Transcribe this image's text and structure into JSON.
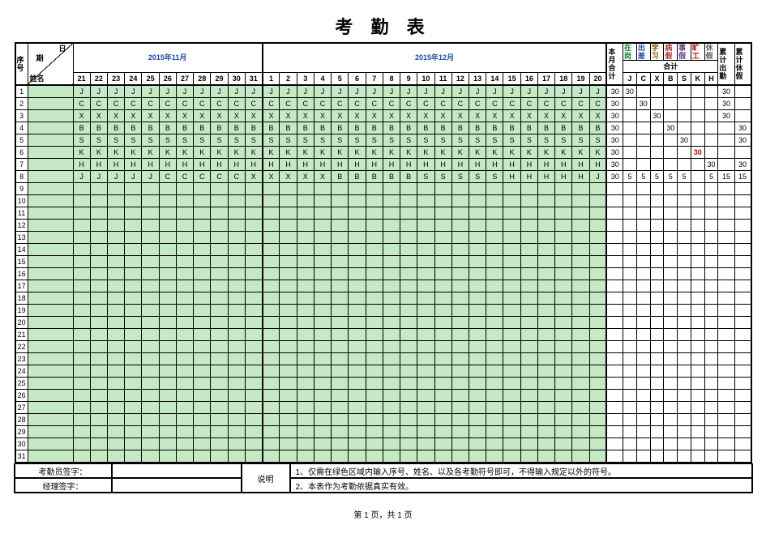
{
  "title": "考 勤 表",
  "header": {
    "seq_label": "序号",
    "corner_top": "日",
    "corner_mid": "期",
    "corner_bot": "姓名",
    "month1": "2015年11月",
    "month2": "2015年12月",
    "days1": [
      "21",
      "22",
      "23",
      "24",
      "25",
      "26",
      "27",
      "28",
      "29",
      "30",
      "31"
    ],
    "days2": [
      "1",
      "2",
      "3",
      "4",
      "5",
      "6",
      "7",
      "8",
      "9",
      "10",
      "11",
      "12",
      "13",
      "14",
      "15",
      "16",
      "17",
      "18",
      "19",
      "20"
    ],
    "month_total": "本月合计",
    "onpost": "在岗",
    "trip": "出差",
    "study": "学习",
    "sick": "病假",
    "personal": "事假",
    "absent": "旷工",
    "rest": "休假",
    "cum_attend": "累计出勤",
    "cum_rest": "累计休假",
    "sub_total": "合计",
    "keys": [
      "J",
      "C",
      "X",
      "B",
      "S",
      "K",
      "H"
    ]
  },
  "chart_data": {
    "type": "table",
    "title": "考勤表",
    "days": [
      21,
      22,
      23,
      24,
      25,
      26,
      27,
      28,
      29,
      30,
      31,
      1,
      2,
      3,
      4,
      5,
      6,
      7,
      8,
      9,
      10,
      11,
      12,
      13,
      14,
      15,
      16,
      17,
      18,
      19,
      20
    ],
    "rows": [
      {
        "seq": 1,
        "marks": [
          "J",
          "J",
          "J",
          "J",
          "J",
          "J",
          "J",
          "J",
          "J",
          "J",
          "J",
          "J",
          "J",
          "J",
          "J",
          "J",
          "J",
          "J",
          "J",
          "J",
          "J",
          "J",
          "J",
          "J",
          "J",
          "J",
          "J",
          "J",
          "J",
          "J",
          "J"
        ],
        "month_total": 30,
        "J": 30,
        "C": "",
        "X": "",
        "B": "",
        "S": "",
        "K": "",
        "H": "",
        "cum_attend": 30,
        "cum_rest": ""
      },
      {
        "seq": 2,
        "marks": [
          "C",
          "C",
          "C",
          "C",
          "C",
          "C",
          "C",
          "C",
          "C",
          "C",
          "C",
          "C",
          "C",
          "C",
          "C",
          "C",
          "C",
          "C",
          "C",
          "C",
          "C",
          "C",
          "C",
          "C",
          "C",
          "C",
          "C",
          "C",
          "C",
          "C",
          "C"
        ],
        "month_total": 30,
        "J": "",
        "C": 30,
        "X": "",
        "B": "",
        "S": "",
        "K": "",
        "H": "",
        "cum_attend": 30,
        "cum_rest": ""
      },
      {
        "seq": 3,
        "marks": [
          "X",
          "X",
          "X",
          "X",
          "X",
          "X",
          "X",
          "X",
          "X",
          "X",
          "X",
          "X",
          "X",
          "X",
          "X",
          "X",
          "X",
          "X",
          "X",
          "X",
          "X",
          "X",
          "X",
          "X",
          "X",
          "X",
          "X",
          "X",
          "X",
          "X",
          "X"
        ],
        "month_total": 30,
        "J": "",
        "C": "",
        "X": 30,
        "B": "",
        "S": "",
        "K": "",
        "H": "",
        "cum_attend": 30,
        "cum_rest": ""
      },
      {
        "seq": 4,
        "marks": [
          "B",
          "B",
          "B",
          "B",
          "B",
          "B",
          "B",
          "B",
          "B",
          "B",
          "B",
          "B",
          "B",
          "B",
          "B",
          "B",
          "B",
          "B",
          "B",
          "B",
          "B",
          "B",
          "B",
          "B",
          "B",
          "B",
          "B",
          "B",
          "B",
          "B",
          "B"
        ],
        "month_total": 30,
        "J": "",
        "C": "",
        "X": "",
        "B": 30,
        "S": "",
        "K": "",
        "H": "",
        "cum_attend": "",
        "cum_rest": 30
      },
      {
        "seq": 5,
        "marks": [
          "S",
          "S",
          "S",
          "S",
          "S",
          "S",
          "S",
          "S",
          "S",
          "S",
          "S",
          "S",
          "S",
          "S",
          "S",
          "S",
          "S",
          "S",
          "S",
          "S",
          "S",
          "S",
          "S",
          "S",
          "S",
          "S",
          "S",
          "S",
          "S",
          "S",
          "S"
        ],
        "month_total": 30,
        "J": "",
        "C": "",
        "X": "",
        "B": "",
        "S": 30,
        "K": "",
        "H": "",
        "cum_attend": "",
        "cum_rest": 30
      },
      {
        "seq": 6,
        "marks": [
          "K",
          "K",
          "K",
          "K",
          "K",
          "K",
          "K",
          "K",
          "K",
          "K",
          "K",
          "K",
          "K",
          "K",
          "K",
          "K",
          "K",
          "K",
          "K",
          "K",
          "K",
          "K",
          "K",
          "K",
          "K",
          "K",
          "K",
          "K",
          "K",
          "K",
          "K"
        ],
        "month_total": 30,
        "J": "",
        "C": "",
        "X": "",
        "B": "",
        "S": "",
        "K": 30,
        "H": "",
        "cum_attend": "",
        "cum_rest": "",
        "k_red": true
      },
      {
        "seq": 7,
        "marks": [
          "H",
          "H",
          "H",
          "H",
          "H",
          "H",
          "H",
          "H",
          "H",
          "H",
          "H",
          "H",
          "H",
          "H",
          "H",
          "H",
          "H",
          "H",
          "H",
          "H",
          "H",
          "H",
          "H",
          "H",
          "H",
          "H",
          "H",
          "H",
          "H",
          "H",
          "H"
        ],
        "month_total": 30,
        "J": "",
        "C": "",
        "X": "",
        "B": "",
        "S": "",
        "K": "",
        "H": 30,
        "cum_attend": "",
        "cum_rest": 30
      },
      {
        "seq": 8,
        "marks": [
          "J",
          "J",
          "J",
          "J",
          "J",
          "C",
          "C",
          "C",
          "C",
          "C",
          "X",
          "X",
          "X",
          "X",
          "X",
          "B",
          "B",
          "B",
          "B",
          "B",
          "S",
          "S",
          "S",
          "S",
          "S",
          "H",
          "H",
          "H",
          "H",
          "H",
          "J"
        ],
        "month_total": 30,
        "J": 5,
        "C": 5,
        "X": 5,
        "B": 5,
        "S": 5,
        "K": "",
        "H": 5,
        "cum_attend": 15,
        "cum_rest": 15
      }
    ],
    "summary_legend": {
      "J": "在岗",
      "C": "出差",
      "X": "学习",
      "B": "病假",
      "S": "事假",
      "K": "旷工",
      "H": "休假"
    }
  },
  "footer": {
    "signer_label": "考勤员签字：",
    "manager_label": "经理签字：",
    "note_label": "说明",
    "note1": "1、仅需在绿色区域内输入序号、姓名、以及各考勤符号即可，不得输入规定以外的符号。",
    "note2": "2、本表作为考勤依据真实有效。"
  },
  "pager": "第 1 页，共 1 页"
}
